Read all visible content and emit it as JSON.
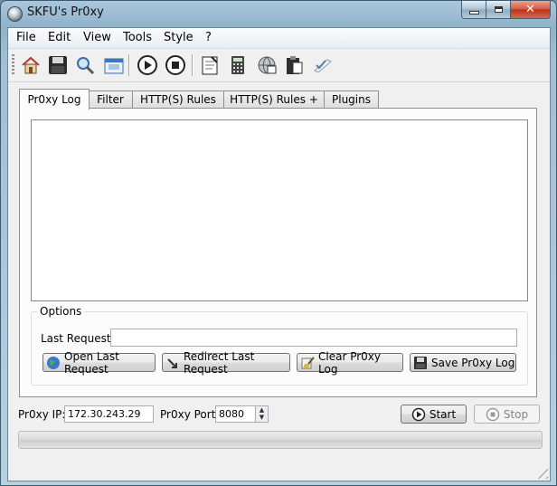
{
  "window": {
    "title": "SKFU's Pr0xy"
  },
  "menu": [
    "File",
    "Edit",
    "View",
    "Tools",
    "Style",
    "?"
  ],
  "toolbar": [
    {
      "icon": "home-icon"
    },
    {
      "icon": "save-icon"
    },
    {
      "icon": "find-icon"
    },
    {
      "icon": "window-icon"
    },
    {
      "icon": "play-icon"
    },
    {
      "icon": "stop-icon"
    },
    {
      "icon": "notepad-icon"
    },
    {
      "icon": "calculator-icon"
    },
    {
      "icon": "globe-network-icon"
    },
    {
      "icon": "clipboard-icon"
    },
    {
      "icon": "checklist-icon"
    }
  ],
  "tabs": [
    "Pr0xy Log",
    "Filter",
    "HTTP(S) Rules",
    "HTTP(S) Rules +",
    "Plugins"
  ],
  "options": {
    "legend": "Options",
    "last_request_label": "Last Request:",
    "last_request_value": "",
    "buttons": {
      "open": "Open Last Request",
      "redirect": "Redirect Last Request",
      "clear": "Clear Pr0xy Log",
      "save": "Save Pr0xy Log"
    }
  },
  "proxy": {
    "ip_label": "Pr0xy IP:",
    "ip_value": "172.30.243.29",
    "port_label": "Pr0xy Port:",
    "port_value": "8080",
    "start_label": "Start",
    "stop_label": "Stop"
  },
  "progress": {
    "value": 0
  },
  "colors": {
    "accent": "#3b78c9",
    "close": "#c8412a"
  }
}
